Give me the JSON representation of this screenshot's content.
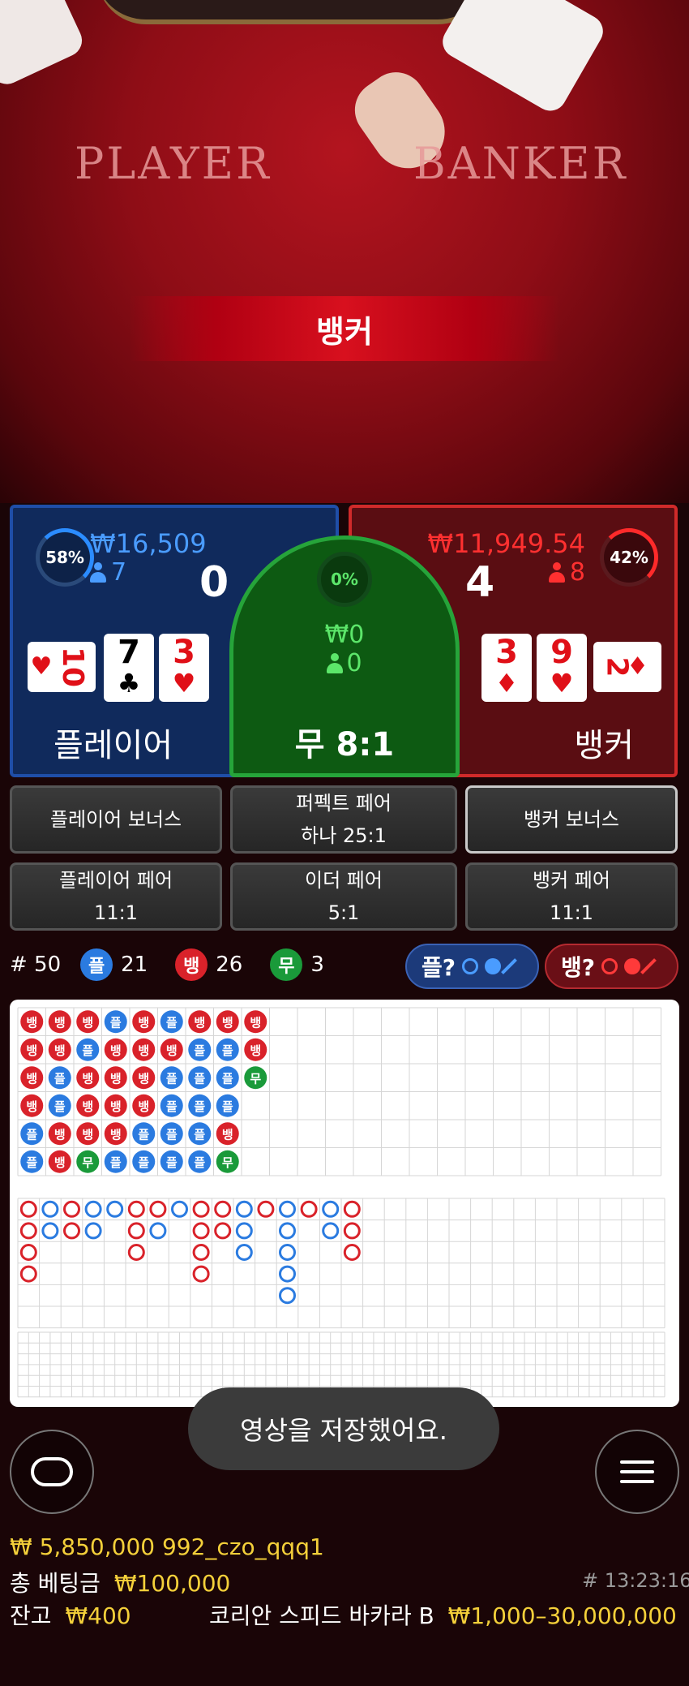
{
  "video": {
    "felt_player": "PLAYER",
    "felt_banker": "BANKER",
    "winner_banner": "뱅커"
  },
  "player_panel": {
    "percent": "58%",
    "amount": "₩16,509",
    "bettors": "7",
    "score": "0",
    "label": "플레이어",
    "cards": [
      {
        "rank": "10",
        "suit": "♥",
        "color": "red",
        "orientation": "sideways"
      },
      {
        "rank": "7",
        "suit": "♣",
        "color": "black"
      },
      {
        "rank": "3",
        "suit": "♥",
        "color": "red"
      }
    ]
  },
  "tie_panel": {
    "percent": "0%",
    "amount": "₩0",
    "bettors": "0",
    "label": "무 8:1"
  },
  "banker_panel": {
    "percent": "42%",
    "amount": "₩11,949.54",
    "bettors": "8",
    "score": "4",
    "label": "뱅커",
    "cards": [
      {
        "rank": "3",
        "suit": "♦",
        "color": "red"
      },
      {
        "rank": "9",
        "suit": "♥",
        "color": "red"
      },
      {
        "rank": "2",
        "suit": "♦",
        "color": "red",
        "orientation": "sideways"
      }
    ]
  },
  "side_bets": {
    "player_bonus": "플레이어 보너스",
    "perfect_pair": "퍼펙트 페어",
    "perfect_pair_odds": "하나 25:1",
    "banker_bonus": "뱅커 보너스",
    "player_pair": "플레이어 페어",
    "player_pair_odds": "11:1",
    "either_pair": "이더 페어",
    "either_pair_odds": "5:1",
    "banker_pair": "뱅커 페어",
    "banker_pair_odds": "11:1"
  },
  "stats": {
    "round_label": "# 50",
    "player_glyph": "플",
    "player_count": "21",
    "banker_glyph": "뱅",
    "banker_count": "26",
    "tie_glyph": "무",
    "tie_count": "3",
    "ask_player": "플?",
    "ask_banker": "뱅?"
  },
  "colors": {
    "player": "#2b7be0",
    "banker": "#d9222a",
    "tie": "#1a9a3a"
  },
  "bead_road": [
    [
      "뱅",
      "뱅",
      "뱅",
      "뱅",
      "플",
      "플"
    ],
    [
      "뱅",
      "뱅",
      "플",
      "플",
      "뱅",
      "뱅"
    ],
    [
      "뱅",
      "플",
      "뱅",
      "뱅",
      "뱅",
      "무"
    ],
    [
      "플",
      "뱅",
      "뱅",
      "뱅",
      "뱅",
      "플"
    ],
    [
      "뱅",
      "뱅",
      "뱅",
      "뱅",
      "플",
      "플"
    ],
    [
      "플",
      "뱅",
      "플",
      "플",
      "플",
      "플"
    ],
    [
      "뱅",
      "플",
      "플",
      "플",
      "플",
      "플"
    ],
    [
      "뱅",
      "플",
      "플",
      "플",
      "뱅",
      "무"
    ],
    [
      "뱅",
      "뱅",
      "무"
    ]
  ],
  "big_road": [
    [
      "B",
      "B",
      "B",
      "B"
    ],
    [
      "P",
      "P"
    ],
    [
      "B",
      "B"
    ],
    [
      "P",
      "P"
    ],
    [
      "P"
    ],
    [
      "B",
      "B",
      "B"
    ],
    [
      "B",
      "P"
    ],
    [
      "P"
    ],
    [
      "B",
      "B",
      "B",
      "B"
    ],
    [
      "B",
      "B"
    ],
    [
      "P",
      "P",
      "P"
    ],
    [
      "B"
    ],
    [
      "P",
      "P",
      "P",
      "P",
      "P"
    ],
    [
      "B"
    ],
    [
      "P",
      "P"
    ],
    [
      "B",
      "B",
      "B"
    ]
  ],
  "toast": "영상을 저장했어요.",
  "footer": {
    "user_line": "₩ 5,850,000 992_czo_qqq1",
    "total_bet_label": "총 베팅금",
    "total_bet_value": "₩100,000",
    "time": "# 13:23:16",
    "balance_label": "잔고",
    "balance_value": "₩400",
    "table_name": "코리안 스피드 바카라 B",
    "limits": "₩1,000–30,000,000"
  }
}
